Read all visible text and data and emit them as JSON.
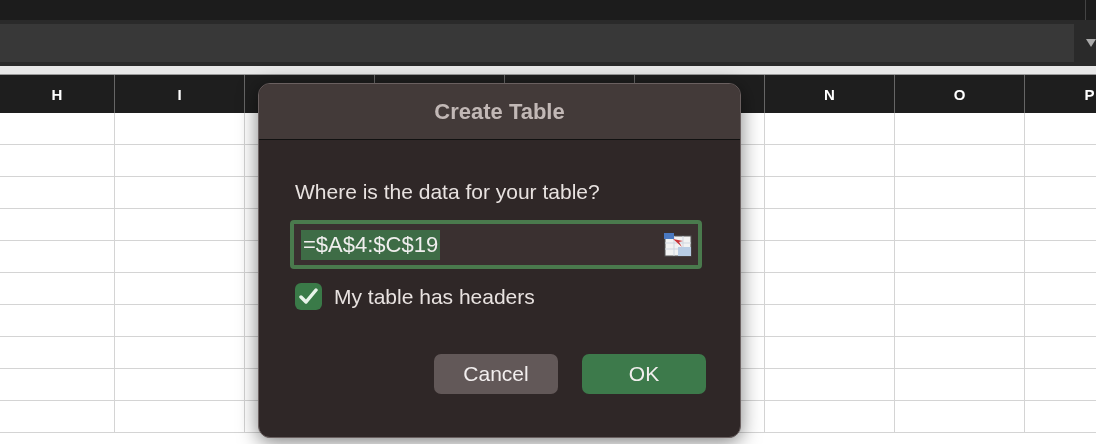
{
  "column_headers": [
    "H",
    "I",
    "N",
    "O",
    "P"
  ],
  "dialog": {
    "title": "Create Table",
    "prompt": "Where is the data for your table?",
    "range_field": {
      "value": "=$A$4:$C$19",
      "selected": true
    },
    "headers_checkbox": {
      "label": "My table has headers",
      "checked": true
    },
    "buttons": [
      {
        "label": "Cancel",
        "kind": "normal"
      },
      {
        "label": "OK",
        "kind": "default"
      }
    ]
  }
}
